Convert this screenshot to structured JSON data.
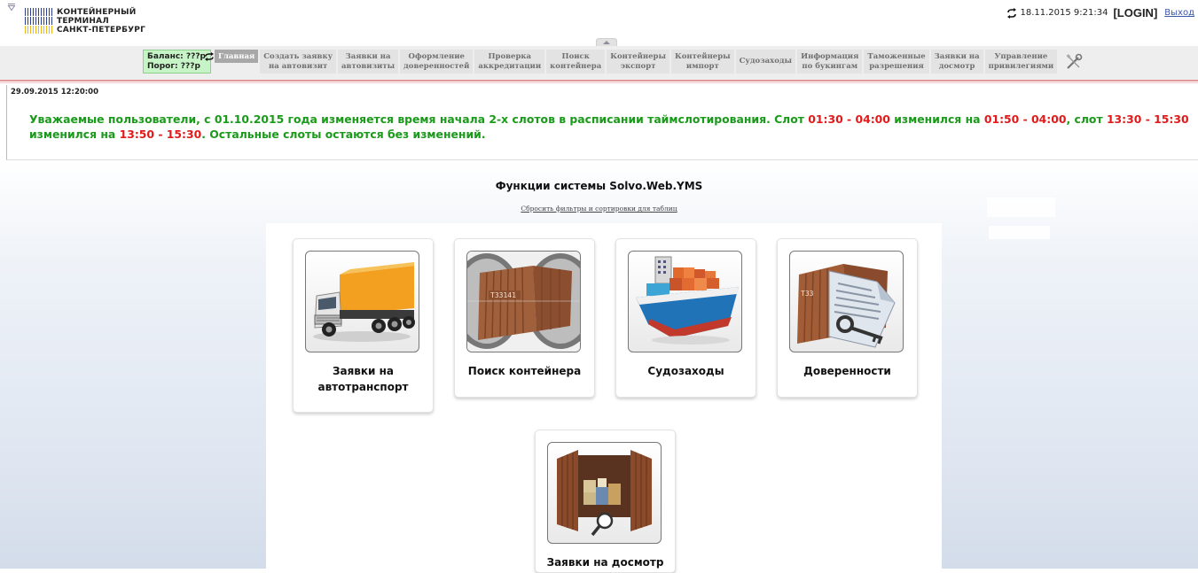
{
  "header": {
    "logo_lines": [
      "КОНТЕЙНЕРНЫЙ",
      "ТЕРМИНАЛ",
      "САНКТ-ПЕТЕРБУРГ"
    ],
    "datetime": "18.11.2015 9:21:34",
    "login": "[LOGIN]",
    "logout": "Выход"
  },
  "balance": {
    "balance_label": "Баланс: ???р",
    "threshold_label": "Порог: ???р"
  },
  "nav": {
    "items": [
      {
        "label": "Главная",
        "active": true
      },
      {
        "label": "Создать заявку\nна автовизит",
        "active": false
      },
      {
        "label": "Заявки на\nавтовизиты",
        "active": false
      },
      {
        "label": "Оформление\nдоверенностей",
        "active": false
      },
      {
        "label": "Проверка\nаккредитации",
        "active": false
      },
      {
        "label": "Поиск\nконтейнера",
        "active": false
      },
      {
        "label": "Контейнеры\nэкспорт",
        "active": false
      },
      {
        "label": "Контейнеры\nимпорт",
        "active": false
      },
      {
        "label": "Судозаходы",
        "active": false
      },
      {
        "label": "Информация\nпо букингам",
        "active": false
      },
      {
        "label": "Таможенные\nразрешения",
        "active": false
      },
      {
        "label": "Заявки на\nдосмотр",
        "active": false
      },
      {
        "label": "Управление\nпривилегиями",
        "active": false
      }
    ]
  },
  "news": {
    "date": "29.09.2015 12:20:00",
    "text_1": "Уважаемые пользователи, с 01.10.2015 года изменяется время начала 2-х слотов в расписании таймслотирования. Слот ",
    "red_1": "01:30 - 04:00",
    "text_2": " изменился на ",
    "red_2": "01:50 - 04:00",
    "text_3": ", слот ",
    "red_3": "13:30 - 15:30",
    "text_4": " изменился на ",
    "red_4": "13:50 - 15:30",
    "text_5": ". Остальные слоты остаются без изменений."
  },
  "main": {
    "title": "Функции системы Solvo.Web.YMS",
    "reset_link": "Сбросить фильтры и сортировки для таблиц",
    "cards": [
      {
        "label": "Заявки на автотранспорт",
        "icon": "truck-icon"
      },
      {
        "label": "Поиск контейнера",
        "icon": "container-search-icon"
      },
      {
        "label": "Судозаходы",
        "icon": "ship-icon"
      },
      {
        "label": "Доверенности",
        "icon": "power-of-attorney-icon"
      },
      {
        "label": "Заявки на досмотр",
        "icon": "inspection-icon"
      }
    ],
    "container_code": "T33141"
  },
  "colors": {
    "news_green": "#1a9a1a",
    "news_red": "#e01b1b",
    "balance_bg": "#c7f4c6",
    "nav_active": "#a8a8a8"
  }
}
